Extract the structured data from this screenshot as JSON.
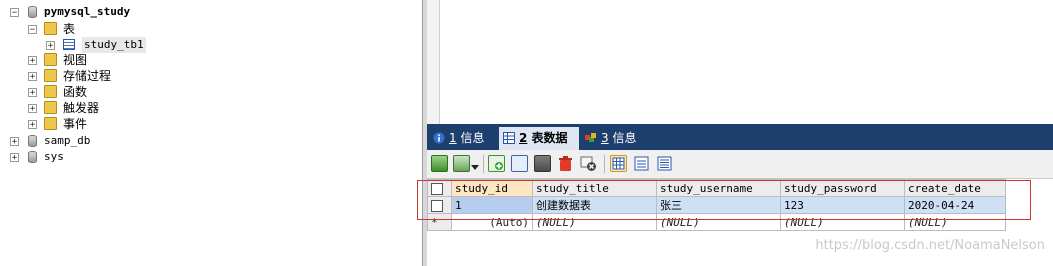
{
  "tree": {
    "items": [
      {
        "label": "pymysql_study"
      },
      {
        "label": "表"
      },
      {
        "label": "study_tb1"
      },
      {
        "label": "视图"
      },
      {
        "label": "存储过程"
      },
      {
        "label": "函数"
      },
      {
        "label": "触发器"
      },
      {
        "label": "事件"
      },
      {
        "label": "samp_db"
      },
      {
        "label": "sys"
      }
    ]
  },
  "tabs": [
    {
      "num": "1",
      "label": " 信息"
    },
    {
      "num": "2",
      "label": " 表数据"
    },
    {
      "num": "3",
      "label": " 信息"
    }
  ],
  "toolbar": {
    "icons": [
      "export-icon",
      "import-icon",
      "dropdown-arrow-icon",
      "insert-row-icon",
      "duplicate-row-icon",
      "save-icon",
      "delete-icon",
      "cancel-icon",
      "grid-view-icon",
      "form-view-icon",
      "text-view-icon"
    ]
  },
  "grid": {
    "columns": [
      "study_id",
      "study_title",
      "study_username",
      "study_password",
      "create_date"
    ],
    "rows": [
      [
        "1",
        "创建数据表",
        "张三",
        "123",
        "2020-04-24"
      ]
    ],
    "new_row": {
      "marker": "*",
      "values": [
        "(Auto)",
        "(NULL)",
        "(NULL)",
        "(NULL)",
        "(NULL)"
      ]
    }
  },
  "watermark": "https://blog.csdn.net/NoamaNelson",
  "colors": {
    "tabbar": "#1d3f6e",
    "highlight": "#d0342c",
    "selection": "#cfe0f6"
  }
}
